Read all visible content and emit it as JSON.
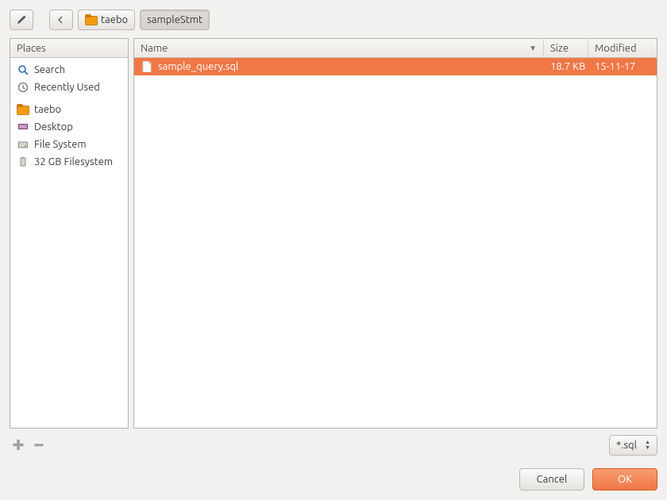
{
  "toolbar": {
    "back_tooltip": "Back"
  },
  "breadcrumb": {
    "home_label": "taebo",
    "current_label": "sampleStmt"
  },
  "sidebar": {
    "header": "Places",
    "items": [
      {
        "icon": "search-icon",
        "label": "Search"
      },
      {
        "icon": "recent-icon",
        "label": "Recently Used"
      },
      {
        "icon": "home-icon",
        "label": "taebo"
      },
      {
        "icon": "desktop-icon",
        "label": "Desktop"
      },
      {
        "icon": "disk-icon",
        "label": "File System"
      },
      {
        "icon": "usb-icon",
        "label": "32 GB Filesystem"
      }
    ]
  },
  "filelist": {
    "columns": {
      "name": "Name",
      "size": "Size",
      "modified": "Modified"
    },
    "rows": [
      {
        "name": "sample_query.sql",
        "size": "18.7 KB",
        "modified": "15-11-17",
        "selected": true
      }
    ]
  },
  "filter": {
    "value": "*.sql"
  },
  "buttons": {
    "cancel": "Cancel",
    "ok": "OK"
  }
}
